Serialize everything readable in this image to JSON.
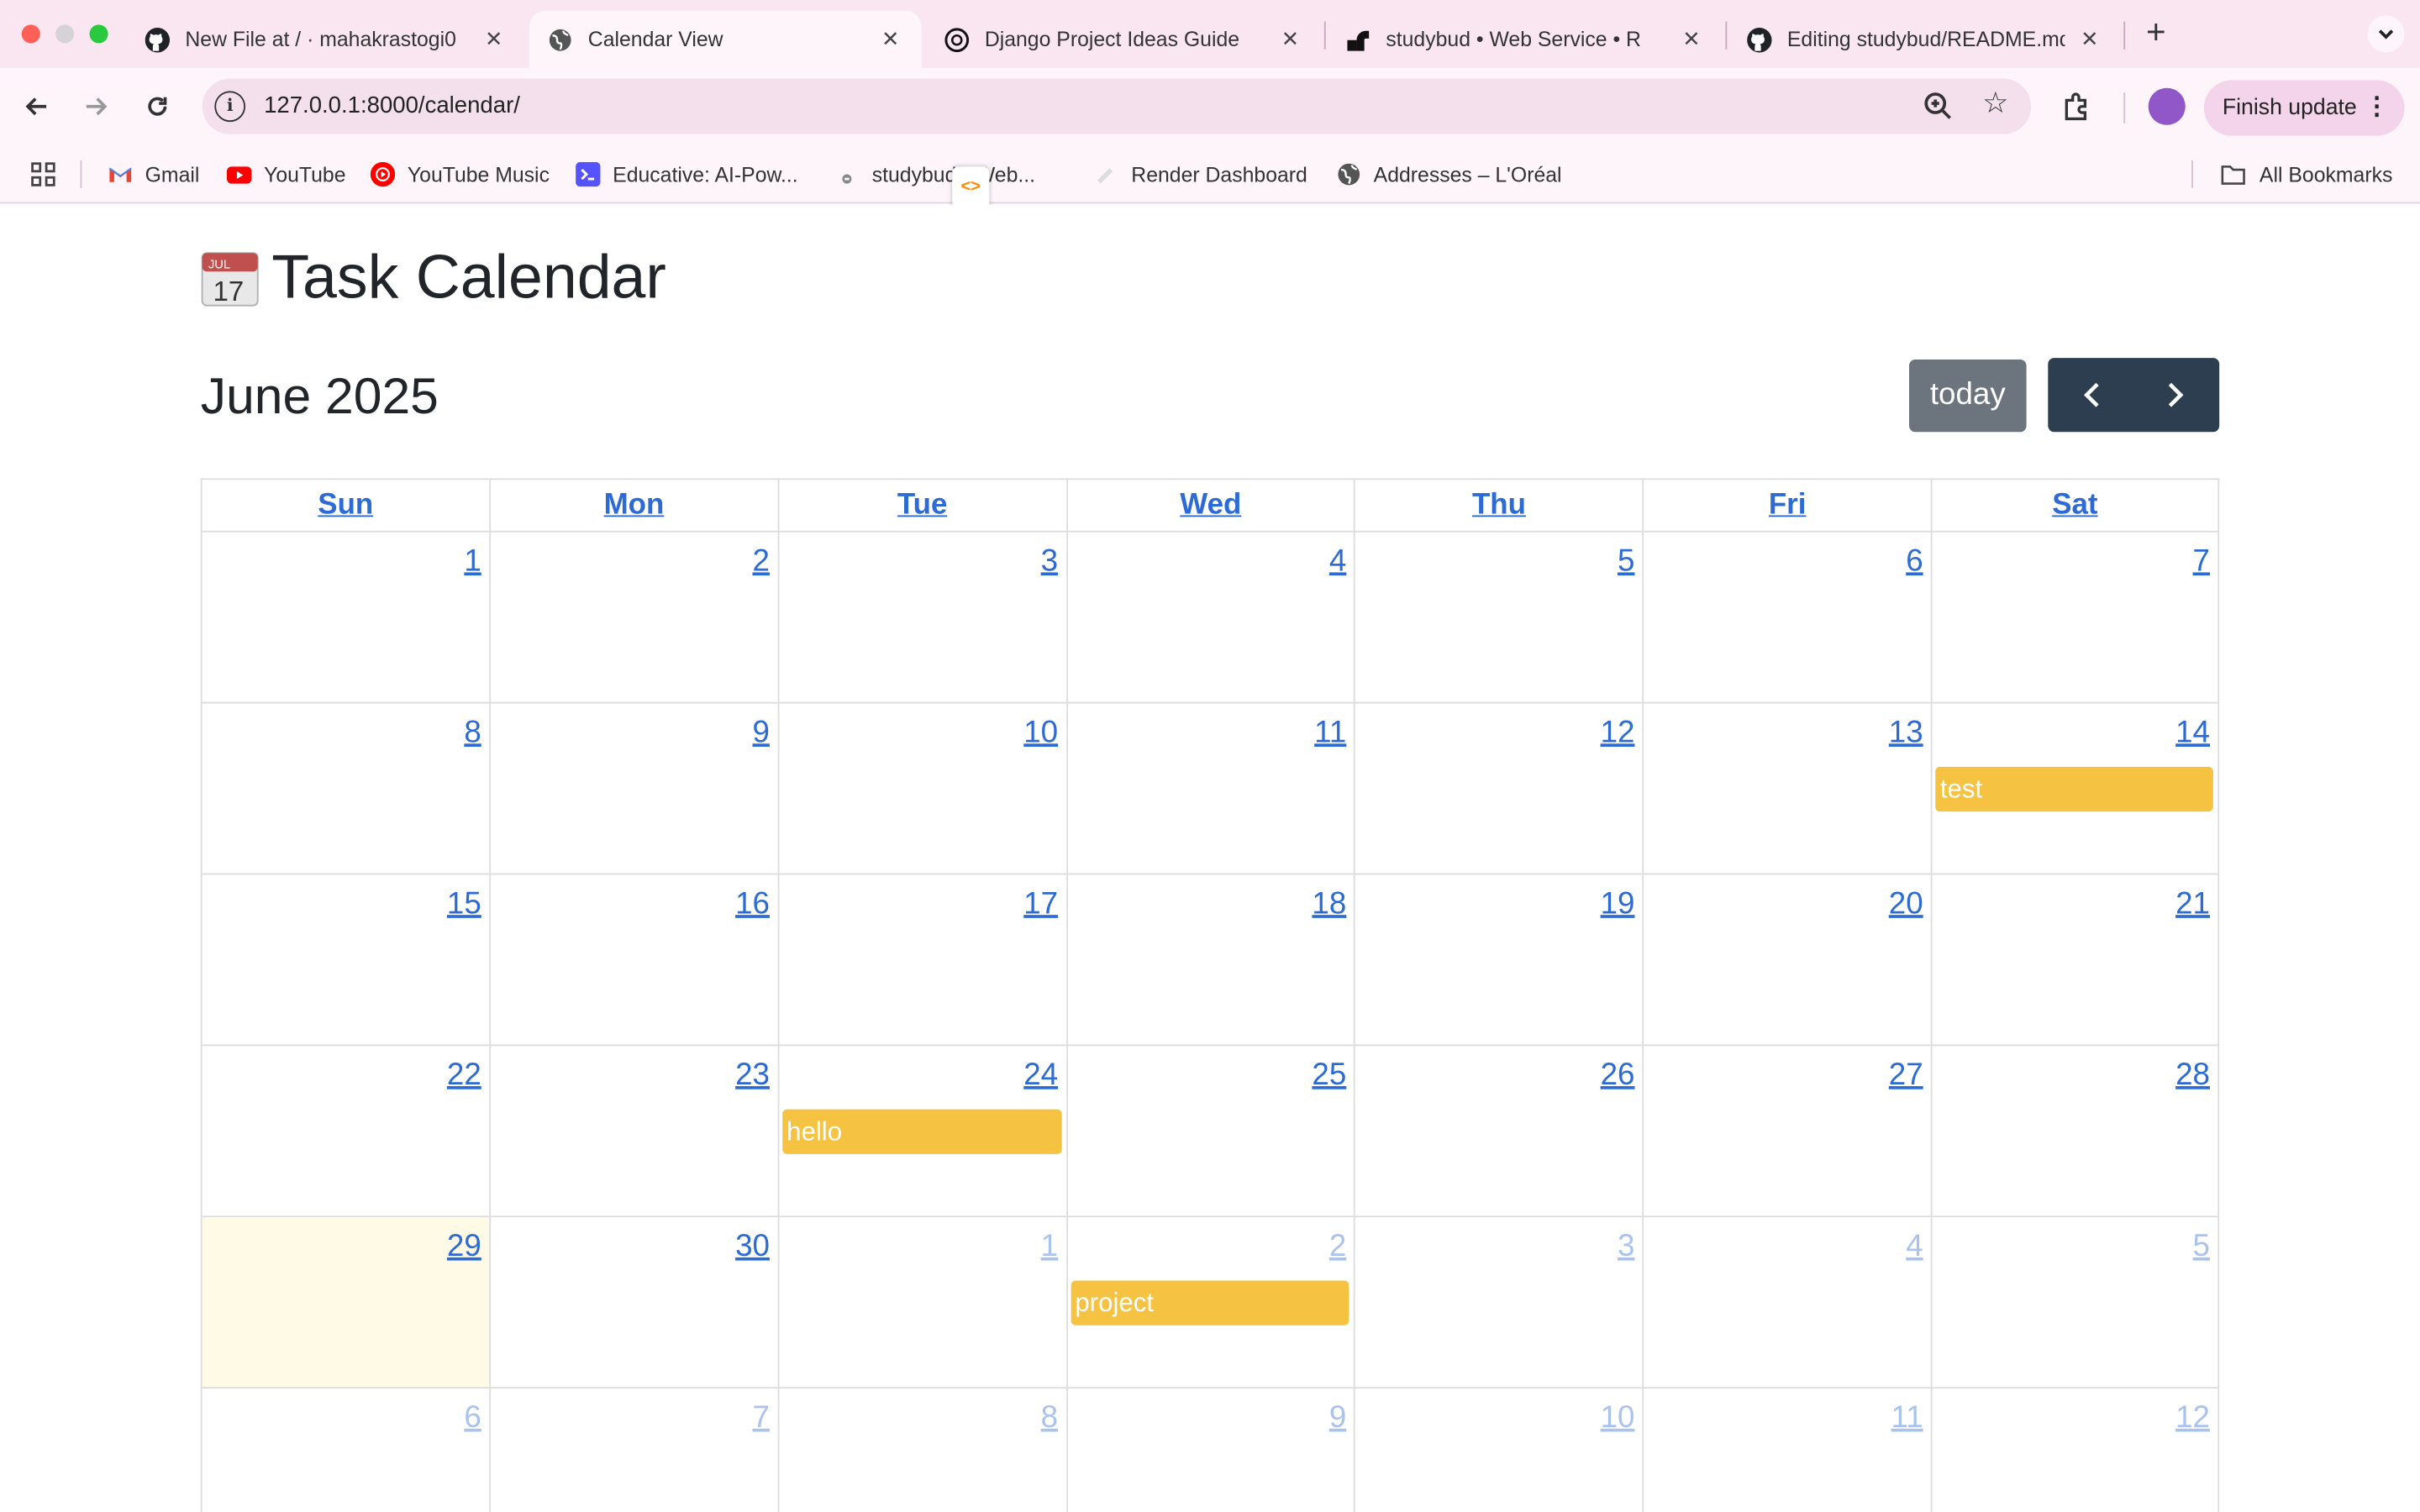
{
  "browser": {
    "tabs": [
      {
        "title": "New File at / · mahakrastogi0",
        "icon": "github-icon",
        "active": false
      },
      {
        "title": "Calendar View",
        "icon": "globe-icon",
        "active": true
      },
      {
        "title": "Django Project Ideas Guide",
        "icon": "openai-icon",
        "active": false
      },
      {
        "title": "studybud • Web Service • R",
        "icon": "render-icon",
        "active": false
      },
      {
        "title": "Editing studybud/README.md",
        "icon": "github-icon",
        "active": false
      }
    ],
    "close_glyph": "✕",
    "new_tab_glyph": "+",
    "url": "127.0.0.1:8000/calendar/",
    "finish_update_label": "Finish update",
    "bookmarks": [
      {
        "label": "Gmail",
        "icon": "gmail-icon"
      },
      {
        "label": "YouTube",
        "icon": "youtube-icon"
      },
      {
        "label": "YouTube Music",
        "icon": "youtube-music-icon"
      },
      {
        "label": "Educative: AI-Pow...",
        "icon": "educative-icon"
      },
      {
        "label": "studybud • Web...",
        "icon": "render-icon"
      },
      {
        "label": "Render Dashboard",
        "icon": "render-icon"
      },
      {
        "label": "Addresses – L'Oréal",
        "icon": "globe-icon"
      }
    ],
    "all_bookmarks_label": "All Bookmarks"
  },
  "page": {
    "title": "Task Calendar",
    "emoji_month": "JUL",
    "emoji_day": "17",
    "month_title": "June 2025",
    "today_label": "today",
    "weekdays": [
      "Sun",
      "Mon",
      "Tue",
      "Wed",
      "Thu",
      "Fri",
      "Sat"
    ],
    "weeks": [
      [
        {
          "day": "1"
        },
        {
          "day": "2"
        },
        {
          "day": "3"
        },
        {
          "day": "4"
        },
        {
          "day": "5"
        },
        {
          "day": "6"
        },
        {
          "day": "7"
        }
      ],
      [
        {
          "day": "8"
        },
        {
          "day": "9"
        },
        {
          "day": "10"
        },
        {
          "day": "11"
        },
        {
          "day": "12"
        },
        {
          "day": "13"
        },
        {
          "day": "14",
          "event": "test"
        }
      ],
      [
        {
          "day": "15"
        },
        {
          "day": "16"
        },
        {
          "day": "17"
        },
        {
          "day": "18"
        },
        {
          "day": "19"
        },
        {
          "day": "20"
        },
        {
          "day": "21"
        }
      ],
      [
        {
          "day": "22"
        },
        {
          "day": "23"
        },
        {
          "day": "24",
          "event": "hello"
        },
        {
          "day": "25"
        },
        {
          "day": "26"
        },
        {
          "day": "27"
        },
        {
          "day": "28"
        }
      ],
      [
        {
          "day": "29",
          "today": true
        },
        {
          "day": "30"
        },
        {
          "day": "1",
          "other": true
        },
        {
          "day": "2",
          "other": true,
          "event": "project"
        },
        {
          "day": "3",
          "other": true
        },
        {
          "day": "4",
          "other": true
        },
        {
          "day": "5",
          "other": true
        }
      ],
      [
        {
          "day": "6",
          "other": true
        },
        {
          "day": "7",
          "other": true
        },
        {
          "day": "8",
          "other": true
        },
        {
          "day": "9",
          "other": true
        },
        {
          "day": "10",
          "other": true
        },
        {
          "day": "11",
          "other": true
        },
        {
          "day": "12",
          "other": true
        }
      ]
    ],
    "colors": {
      "event": "#f5c242",
      "link": "#2c6bd6",
      "today_bg": "#fefae6",
      "nav_bg": "#2c3e50",
      "today_btn_bg": "#6c757d"
    }
  }
}
